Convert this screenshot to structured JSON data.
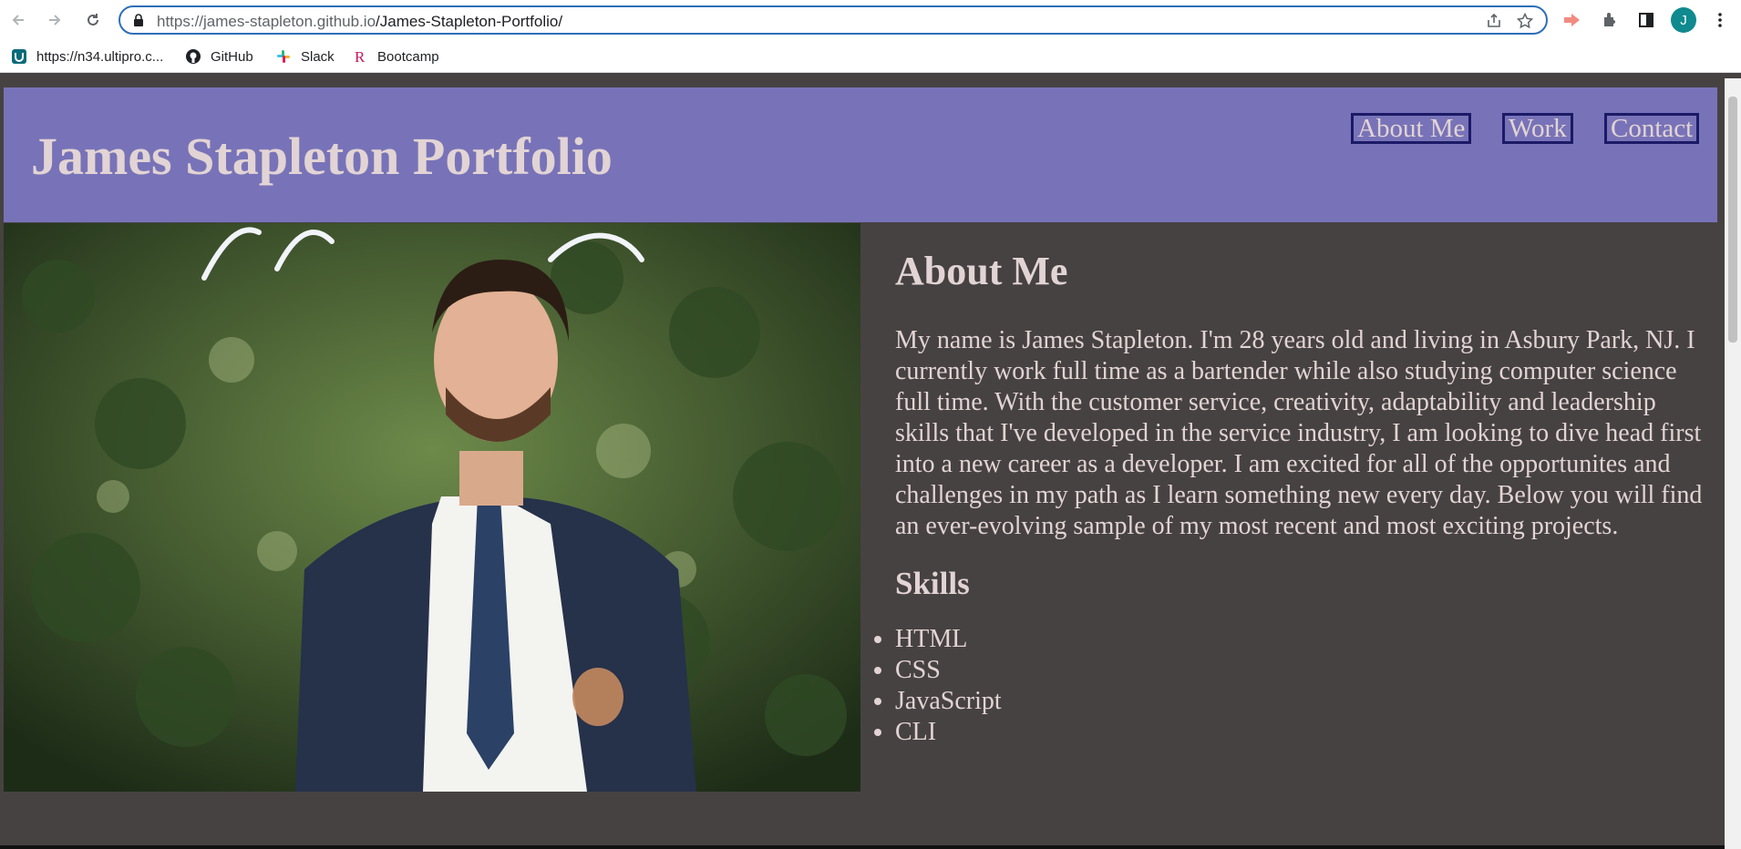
{
  "browser": {
    "url_host": "https://james-stapleton.github.io",
    "url_path": "/James-Stapleton-Portfolio/",
    "avatar_letter": "J",
    "bookmarks": [
      {
        "label": "https://n34.ultipro.c...",
        "icon": "ultipro-icon"
      },
      {
        "label": "GitHub",
        "icon": "github-icon"
      },
      {
        "label": "Slack",
        "icon": "slack-icon"
      },
      {
        "label": "Bootcamp",
        "icon": "bootcamp-icon"
      }
    ]
  },
  "header": {
    "title": "James Stapleton Portfolio",
    "nav": [
      "About Me",
      "Work",
      "Contact"
    ],
    "bg_color": "#7873b8",
    "text_color": "#e2d4d4"
  },
  "about": {
    "heading": "About Me",
    "bio": "My name is James Stapleton. I'm 28 years old and living in Asbury Park, NJ. I currently work full time as a bartender while also studying computer science full time. With the customer service, creativity, adaptability and leadership skills that I've developed in the service industry, I am looking to dive head first into a new career as a developer. I am excited for all of the opportunites and challenges in my path as I learn something new every day. Below you will find an ever-evolving sample of my most recent and most exciting projects.",
    "skills_heading": "Skills",
    "skills": [
      "HTML",
      "CSS",
      "JavaScript",
      "CLI"
    ]
  },
  "page_bg": "#474242"
}
